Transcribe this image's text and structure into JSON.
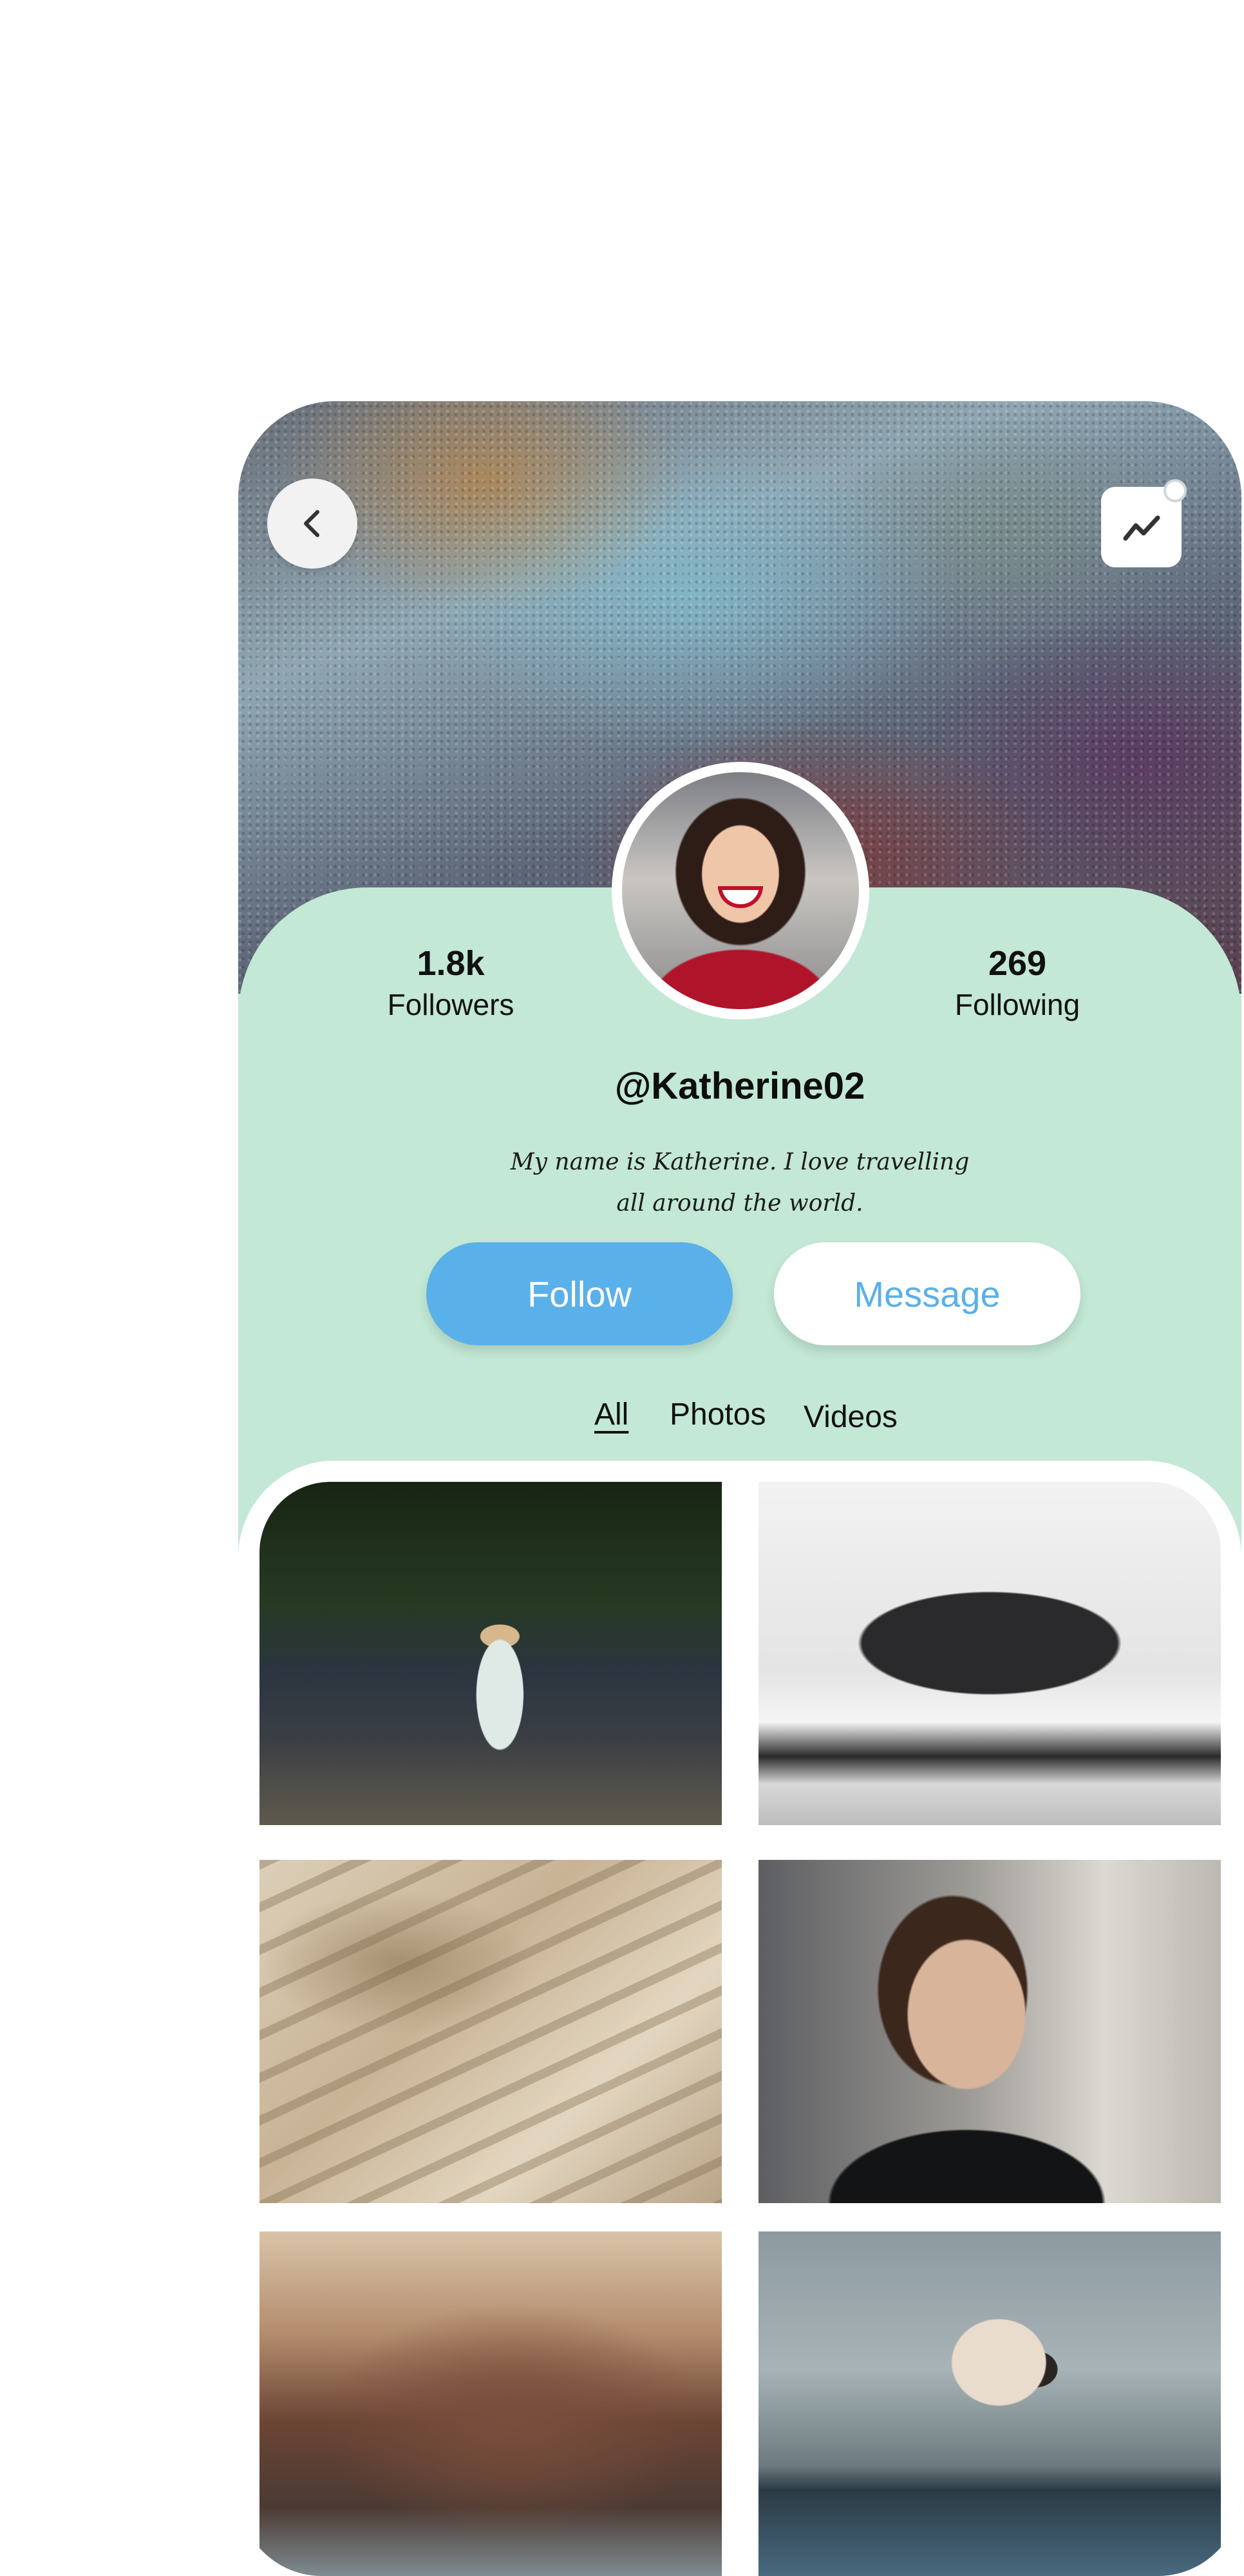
{
  "profile": {
    "followers": {
      "count": "1.8k",
      "label": "Followers"
    },
    "following": {
      "count": "269",
      "label": "Following"
    },
    "handle": "@Katherine02",
    "bio_line1": "My name is Katherine. I love travelling",
    "bio_line2": "all around the world."
  },
  "actions": {
    "follow_label": "Follow",
    "message_label": "Message"
  },
  "tabs": [
    {
      "label": "All",
      "active": true
    },
    {
      "label": "Photos",
      "active": false
    },
    {
      "label": "Videos",
      "active": false
    }
  ],
  "icons": {
    "back": "chevron-left-icon",
    "stats": "trend-chart-icon"
  },
  "colors": {
    "accent_blue": "#5ab0e9",
    "panel_mint": "#c3e8d6"
  }
}
